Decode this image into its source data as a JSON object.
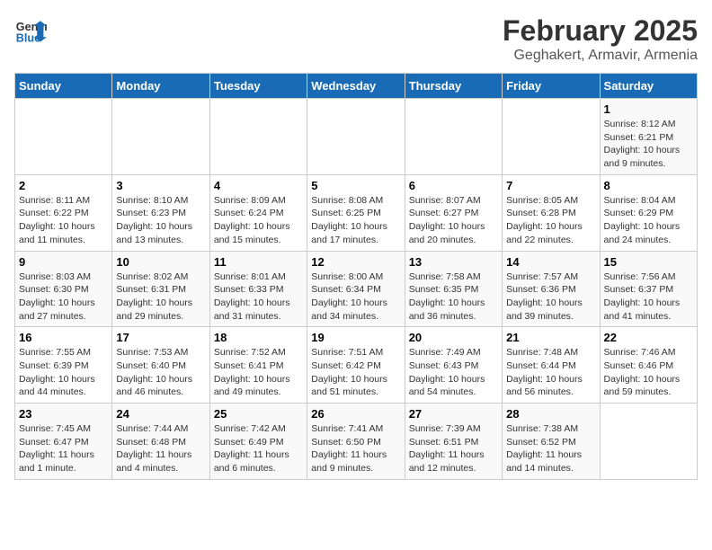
{
  "header": {
    "logo_line1": "General",
    "logo_line2": "Blue",
    "month_title": "February 2025",
    "location": "Geghakert, Armavir, Armenia"
  },
  "weekdays": [
    "Sunday",
    "Monday",
    "Tuesday",
    "Wednesday",
    "Thursday",
    "Friday",
    "Saturday"
  ],
  "weeks": [
    [
      {
        "day": "",
        "info": ""
      },
      {
        "day": "",
        "info": ""
      },
      {
        "day": "",
        "info": ""
      },
      {
        "day": "",
        "info": ""
      },
      {
        "day": "",
        "info": ""
      },
      {
        "day": "",
        "info": ""
      },
      {
        "day": "1",
        "info": "Sunrise: 8:12 AM\nSunset: 6:21 PM\nDaylight: 10 hours and 9 minutes."
      }
    ],
    [
      {
        "day": "2",
        "info": "Sunrise: 8:11 AM\nSunset: 6:22 PM\nDaylight: 10 hours and 11 minutes."
      },
      {
        "day": "3",
        "info": "Sunrise: 8:10 AM\nSunset: 6:23 PM\nDaylight: 10 hours and 13 minutes."
      },
      {
        "day": "4",
        "info": "Sunrise: 8:09 AM\nSunset: 6:24 PM\nDaylight: 10 hours and 15 minutes."
      },
      {
        "day": "5",
        "info": "Sunrise: 8:08 AM\nSunset: 6:25 PM\nDaylight: 10 hours and 17 minutes."
      },
      {
        "day": "6",
        "info": "Sunrise: 8:07 AM\nSunset: 6:27 PM\nDaylight: 10 hours and 20 minutes."
      },
      {
        "day": "7",
        "info": "Sunrise: 8:05 AM\nSunset: 6:28 PM\nDaylight: 10 hours and 22 minutes."
      },
      {
        "day": "8",
        "info": "Sunrise: 8:04 AM\nSunset: 6:29 PM\nDaylight: 10 hours and 24 minutes."
      }
    ],
    [
      {
        "day": "9",
        "info": "Sunrise: 8:03 AM\nSunset: 6:30 PM\nDaylight: 10 hours and 27 minutes."
      },
      {
        "day": "10",
        "info": "Sunrise: 8:02 AM\nSunset: 6:31 PM\nDaylight: 10 hours and 29 minutes."
      },
      {
        "day": "11",
        "info": "Sunrise: 8:01 AM\nSunset: 6:33 PM\nDaylight: 10 hours and 31 minutes."
      },
      {
        "day": "12",
        "info": "Sunrise: 8:00 AM\nSunset: 6:34 PM\nDaylight: 10 hours and 34 minutes."
      },
      {
        "day": "13",
        "info": "Sunrise: 7:58 AM\nSunset: 6:35 PM\nDaylight: 10 hours and 36 minutes."
      },
      {
        "day": "14",
        "info": "Sunrise: 7:57 AM\nSunset: 6:36 PM\nDaylight: 10 hours and 39 minutes."
      },
      {
        "day": "15",
        "info": "Sunrise: 7:56 AM\nSunset: 6:37 PM\nDaylight: 10 hours and 41 minutes."
      }
    ],
    [
      {
        "day": "16",
        "info": "Sunrise: 7:55 AM\nSunset: 6:39 PM\nDaylight: 10 hours and 44 minutes."
      },
      {
        "day": "17",
        "info": "Sunrise: 7:53 AM\nSunset: 6:40 PM\nDaylight: 10 hours and 46 minutes."
      },
      {
        "day": "18",
        "info": "Sunrise: 7:52 AM\nSunset: 6:41 PM\nDaylight: 10 hours and 49 minutes."
      },
      {
        "day": "19",
        "info": "Sunrise: 7:51 AM\nSunset: 6:42 PM\nDaylight: 10 hours and 51 minutes."
      },
      {
        "day": "20",
        "info": "Sunrise: 7:49 AM\nSunset: 6:43 PM\nDaylight: 10 hours and 54 minutes."
      },
      {
        "day": "21",
        "info": "Sunrise: 7:48 AM\nSunset: 6:44 PM\nDaylight: 10 hours and 56 minutes."
      },
      {
        "day": "22",
        "info": "Sunrise: 7:46 AM\nSunset: 6:46 PM\nDaylight: 10 hours and 59 minutes."
      }
    ],
    [
      {
        "day": "23",
        "info": "Sunrise: 7:45 AM\nSunset: 6:47 PM\nDaylight: 11 hours and 1 minute."
      },
      {
        "day": "24",
        "info": "Sunrise: 7:44 AM\nSunset: 6:48 PM\nDaylight: 11 hours and 4 minutes."
      },
      {
        "day": "25",
        "info": "Sunrise: 7:42 AM\nSunset: 6:49 PM\nDaylight: 11 hours and 6 minutes."
      },
      {
        "day": "26",
        "info": "Sunrise: 7:41 AM\nSunset: 6:50 PM\nDaylight: 11 hours and 9 minutes."
      },
      {
        "day": "27",
        "info": "Sunrise: 7:39 AM\nSunset: 6:51 PM\nDaylight: 11 hours and 12 minutes."
      },
      {
        "day": "28",
        "info": "Sunrise: 7:38 AM\nSunset: 6:52 PM\nDaylight: 11 hours and 14 minutes."
      },
      {
        "day": "",
        "info": ""
      }
    ]
  ]
}
